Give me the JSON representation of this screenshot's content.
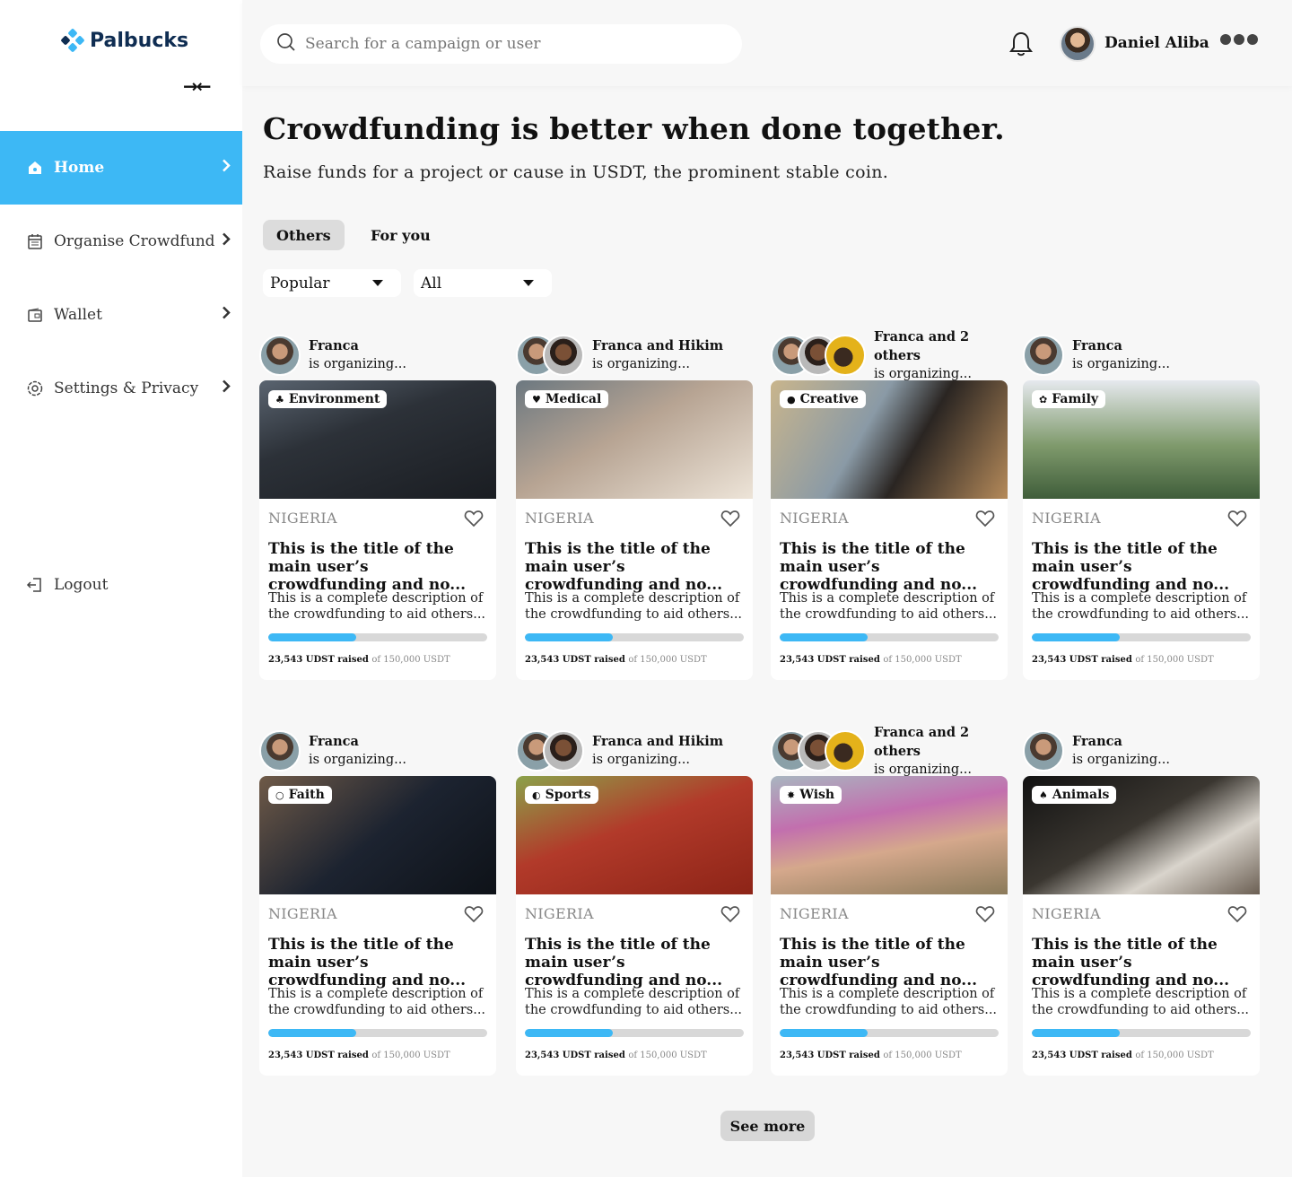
{
  "app": {
    "name": "Palbucks",
    "brand_color": "#3db8f5"
  },
  "sidebar": {
    "collapse_icon": "collapse-arrows-icon",
    "items": [
      {
        "label": "Home",
        "icon": "home-icon",
        "active": true
      },
      {
        "label": "Organise Crowdfund",
        "icon": "calendar-icon",
        "active": false
      },
      {
        "label": "Wallet",
        "icon": "wallet-icon",
        "active": false
      },
      {
        "label": "Settings & Privacy",
        "icon": "settings-icon",
        "active": false
      }
    ],
    "logout_label": "Logout"
  },
  "header": {
    "search_placeholder": "Search for a campaign or user",
    "user_name": "Daniel Aliba"
  },
  "main": {
    "headline": "Crowdfunding is better when done together.",
    "subline": "Raise funds for a project or cause in USDT, the prominent stable coin.",
    "tabs": [
      {
        "label": "Others",
        "selected": true
      },
      {
        "label": "For you",
        "selected": false
      }
    ],
    "sort_value": "Popular",
    "filter_value": "All",
    "see_more_label": "See more"
  },
  "campaigns": [
    {
      "organizer": "Franca",
      "organizing": "is organizing...",
      "category": "Environment",
      "country": "NIGERIA",
      "title": "This is the title of the main user’s crowdfunding and no...",
      "description": "This is a complete description of the crowdfunding to aid others...",
      "raised": "23,543 UDST raised",
      "goal": "of 150,000 USDT",
      "progress": 0.4
    },
    {
      "organizer": "Franca and Hikim",
      "organizing": "is organizing...",
      "category": "Medical",
      "country": "NIGERIA",
      "title": "This is the title of the main user’s crowdfunding and no...",
      "description": "This is a complete description of the crowdfunding to aid others...",
      "raised": "23,543 UDST raised",
      "goal": "of 150,000 USDT",
      "progress": 0.4
    },
    {
      "organizer": "Franca and 2 others",
      "organizing": "is organizing...",
      "category": "Creative",
      "country": "NIGERIA",
      "title": "This is the title of the main user’s crowdfunding and no...",
      "description": "This is a complete description of the crowdfunding to aid others...",
      "raised": "23,543 UDST raised",
      "goal": "of 150,000 USDT",
      "progress": 0.4
    },
    {
      "organizer": "Franca",
      "organizing": "is organizing...",
      "category": "Family",
      "country": "NIGERIA",
      "title": "This is the title of the main user’s crowdfunding and no...",
      "description": "This is a complete description of the crowdfunding to aid others...",
      "raised": "23,543 UDST raised",
      "goal": "of 150,000 USDT",
      "progress": 0.4
    },
    {
      "organizer": "Franca",
      "organizing": "is organizing...",
      "category": "Faith",
      "country": "NIGERIA",
      "title": "This is the title of the main user’s crowdfunding and no...",
      "description": "This is a complete description of the crowdfunding to aid others...",
      "raised": "23,543 UDST raised",
      "goal": "of 150,000 USDT",
      "progress": 0.4
    },
    {
      "organizer": "Franca and Hikim",
      "organizing": "is organizing...",
      "category": "Sports",
      "country": "NIGERIA",
      "title": "This is the title of the main user’s crowdfunding and no...",
      "description": "This is a complete description of the crowdfunding to aid others...",
      "raised": "23,543 UDST raised",
      "goal": "of 150,000 USDT",
      "progress": 0.4
    },
    {
      "organizer": "Franca and 2 others",
      "organizing": "is organizing...",
      "category": "Wish",
      "country": "NIGERIA",
      "title": "This is the title of the main user’s crowdfunding and no...",
      "description": "This is a complete description of the crowdfunding to aid others...",
      "raised": "23,543 UDST raised",
      "goal": "of 150,000 USDT",
      "progress": 0.4
    },
    {
      "organizer": "Franca",
      "organizing": "is organizing...",
      "category": "Animals",
      "country": "NIGERIA",
      "title": "This is the title of the main user’s crowdfunding and no...",
      "description": "This is a complete description of the crowdfunding to aid others...",
      "raised": "23,543 UDST raised",
      "goal": "of 150,000 USDT",
      "progress": 0.4
    }
  ]
}
